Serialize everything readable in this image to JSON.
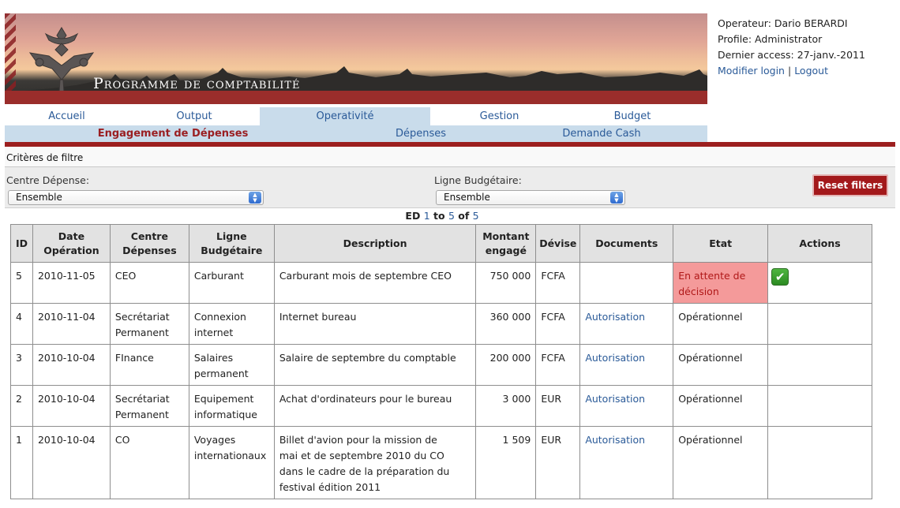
{
  "header": {
    "title": "Programme de comptabilité"
  },
  "user": {
    "operator_line": "Operateur: Dario BERARDI",
    "profile_line": "Profile: Administrator",
    "last_access_line": "Dernier access: 27-janv.-2011",
    "modify_login_label": "Modifier login",
    "separator": "|",
    "logout_label": "Logout"
  },
  "nav": {
    "main": [
      {
        "label": "Accueil"
      },
      {
        "label": "Output"
      },
      {
        "label": "Operativité"
      },
      {
        "label": "Gestion"
      },
      {
        "label": "Budget"
      }
    ],
    "active_main": "Operativité",
    "sub": [
      {
        "label": "Engagement de Dépenses"
      },
      {
        "label": "Dépenses"
      },
      {
        "label": "Demande Cash"
      }
    ],
    "active_sub": "Engagement de Dépenses"
  },
  "filters": {
    "header": "Critères de filtre",
    "centre_label": "Centre Dépense:",
    "centre_value": "Ensemble",
    "ligne_label": "Ligne Budgétaire:",
    "ligne_value": "Ensemble",
    "reset_label": "Reset filters"
  },
  "pager": {
    "prefix": "ED",
    "from": "1",
    "to_word": "to",
    "to": "5",
    "of_word": "of",
    "total": "5"
  },
  "table": {
    "columns": {
      "id": "ID",
      "date_1": "Date",
      "date_2": "Opération",
      "centre_1": "Centre",
      "centre_2": "Dépenses",
      "ligne_1": "Ligne",
      "ligne_2": "Budgétaire",
      "description": "Description",
      "montant_1": "Montant",
      "montant_2": "engagé",
      "devise": "Dévise",
      "documents": "Documents",
      "etat": "Etat",
      "actions": "Actions"
    },
    "rows": [
      {
        "id": "5",
        "date": "2010-11-05",
        "centre_1": "CEO",
        "centre_2": "",
        "ligne_1": "Carburant",
        "ligne_2": "",
        "description": "Carburant mois de septembre CEO",
        "montant": "750 000",
        "devise": "FCFA",
        "document": "",
        "etat_1": "En attente de",
        "etat_2": "décision",
        "action_icon": "checkmark-icon"
      },
      {
        "id": "4",
        "date": "2010-11-04",
        "centre_1": "Secrétariat",
        "centre_2": "Permanent",
        "ligne_1": "Connexion",
        "ligne_2": "internet",
        "description": "Internet bureau",
        "montant": "360 000",
        "devise": "FCFA",
        "document": "Autorisation",
        "etat_1": "Opérationnel",
        "etat_2": ""
      },
      {
        "id": "3",
        "date": "2010-10-04",
        "centre_1": "FInance",
        "centre_2": "",
        "ligne_1": "Salaires",
        "ligne_2": "permanent",
        "description": "Salaire de septembre du comptable",
        "montant": "200 000",
        "devise": "FCFA",
        "document": "Autorisation",
        "etat_1": "Opérationnel",
        "etat_2": ""
      },
      {
        "id": "2",
        "date": "2010-10-04",
        "centre_1": "Secrétariat",
        "centre_2": "Permanent",
        "ligne_1": "Equipement",
        "ligne_2": "informatique",
        "description": "Achat d'ordinateurs pour le bureau",
        "montant": "3 000",
        "devise": "EUR",
        "document": "Autorisation",
        "etat_1": "Opérationnel",
        "etat_2": ""
      },
      {
        "id": "1",
        "date": "2010-10-04",
        "centre_1": "CO",
        "centre_2": "",
        "ligne_1": "Voyages",
        "ligne_2": "internationaux",
        "description_lines": [
          "Billet d'avion pour la mission de",
          "mai et de septembre 2010 du CO",
          "dans le cadre de la préparation du",
          "festival édition 2011"
        ],
        "montant": "1 509",
        "devise": "EUR",
        "document": "Autorisation",
        "etat_1": "Opérationnel",
        "etat_2": ""
      }
    ]
  },
  "colors": {
    "brand_red": "#9c1f1f",
    "link_blue": "#2a5a98",
    "nav_active_bg": "#c9dceb",
    "pending_bg": "#f49a9a"
  }
}
